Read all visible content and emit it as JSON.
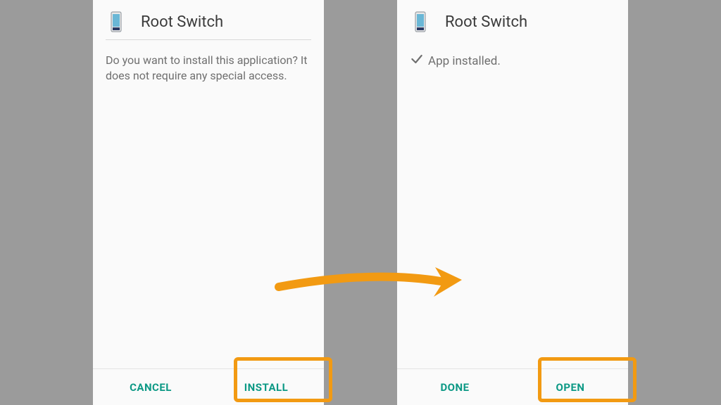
{
  "left": {
    "app_title": "Root Switch",
    "prompt_text": "Do you want to install this application? It does not require any special access.",
    "cancel_label": "CANCEL",
    "install_label": "INSTALL"
  },
  "right": {
    "app_title": "Root Switch",
    "installed_text": "App installed.",
    "done_label": "DONE",
    "open_label": "OPEN"
  },
  "colors": {
    "accent": "#0c9985",
    "highlight": "#f29a12",
    "background": "#9b9b9b",
    "surface": "#fafafa"
  }
}
